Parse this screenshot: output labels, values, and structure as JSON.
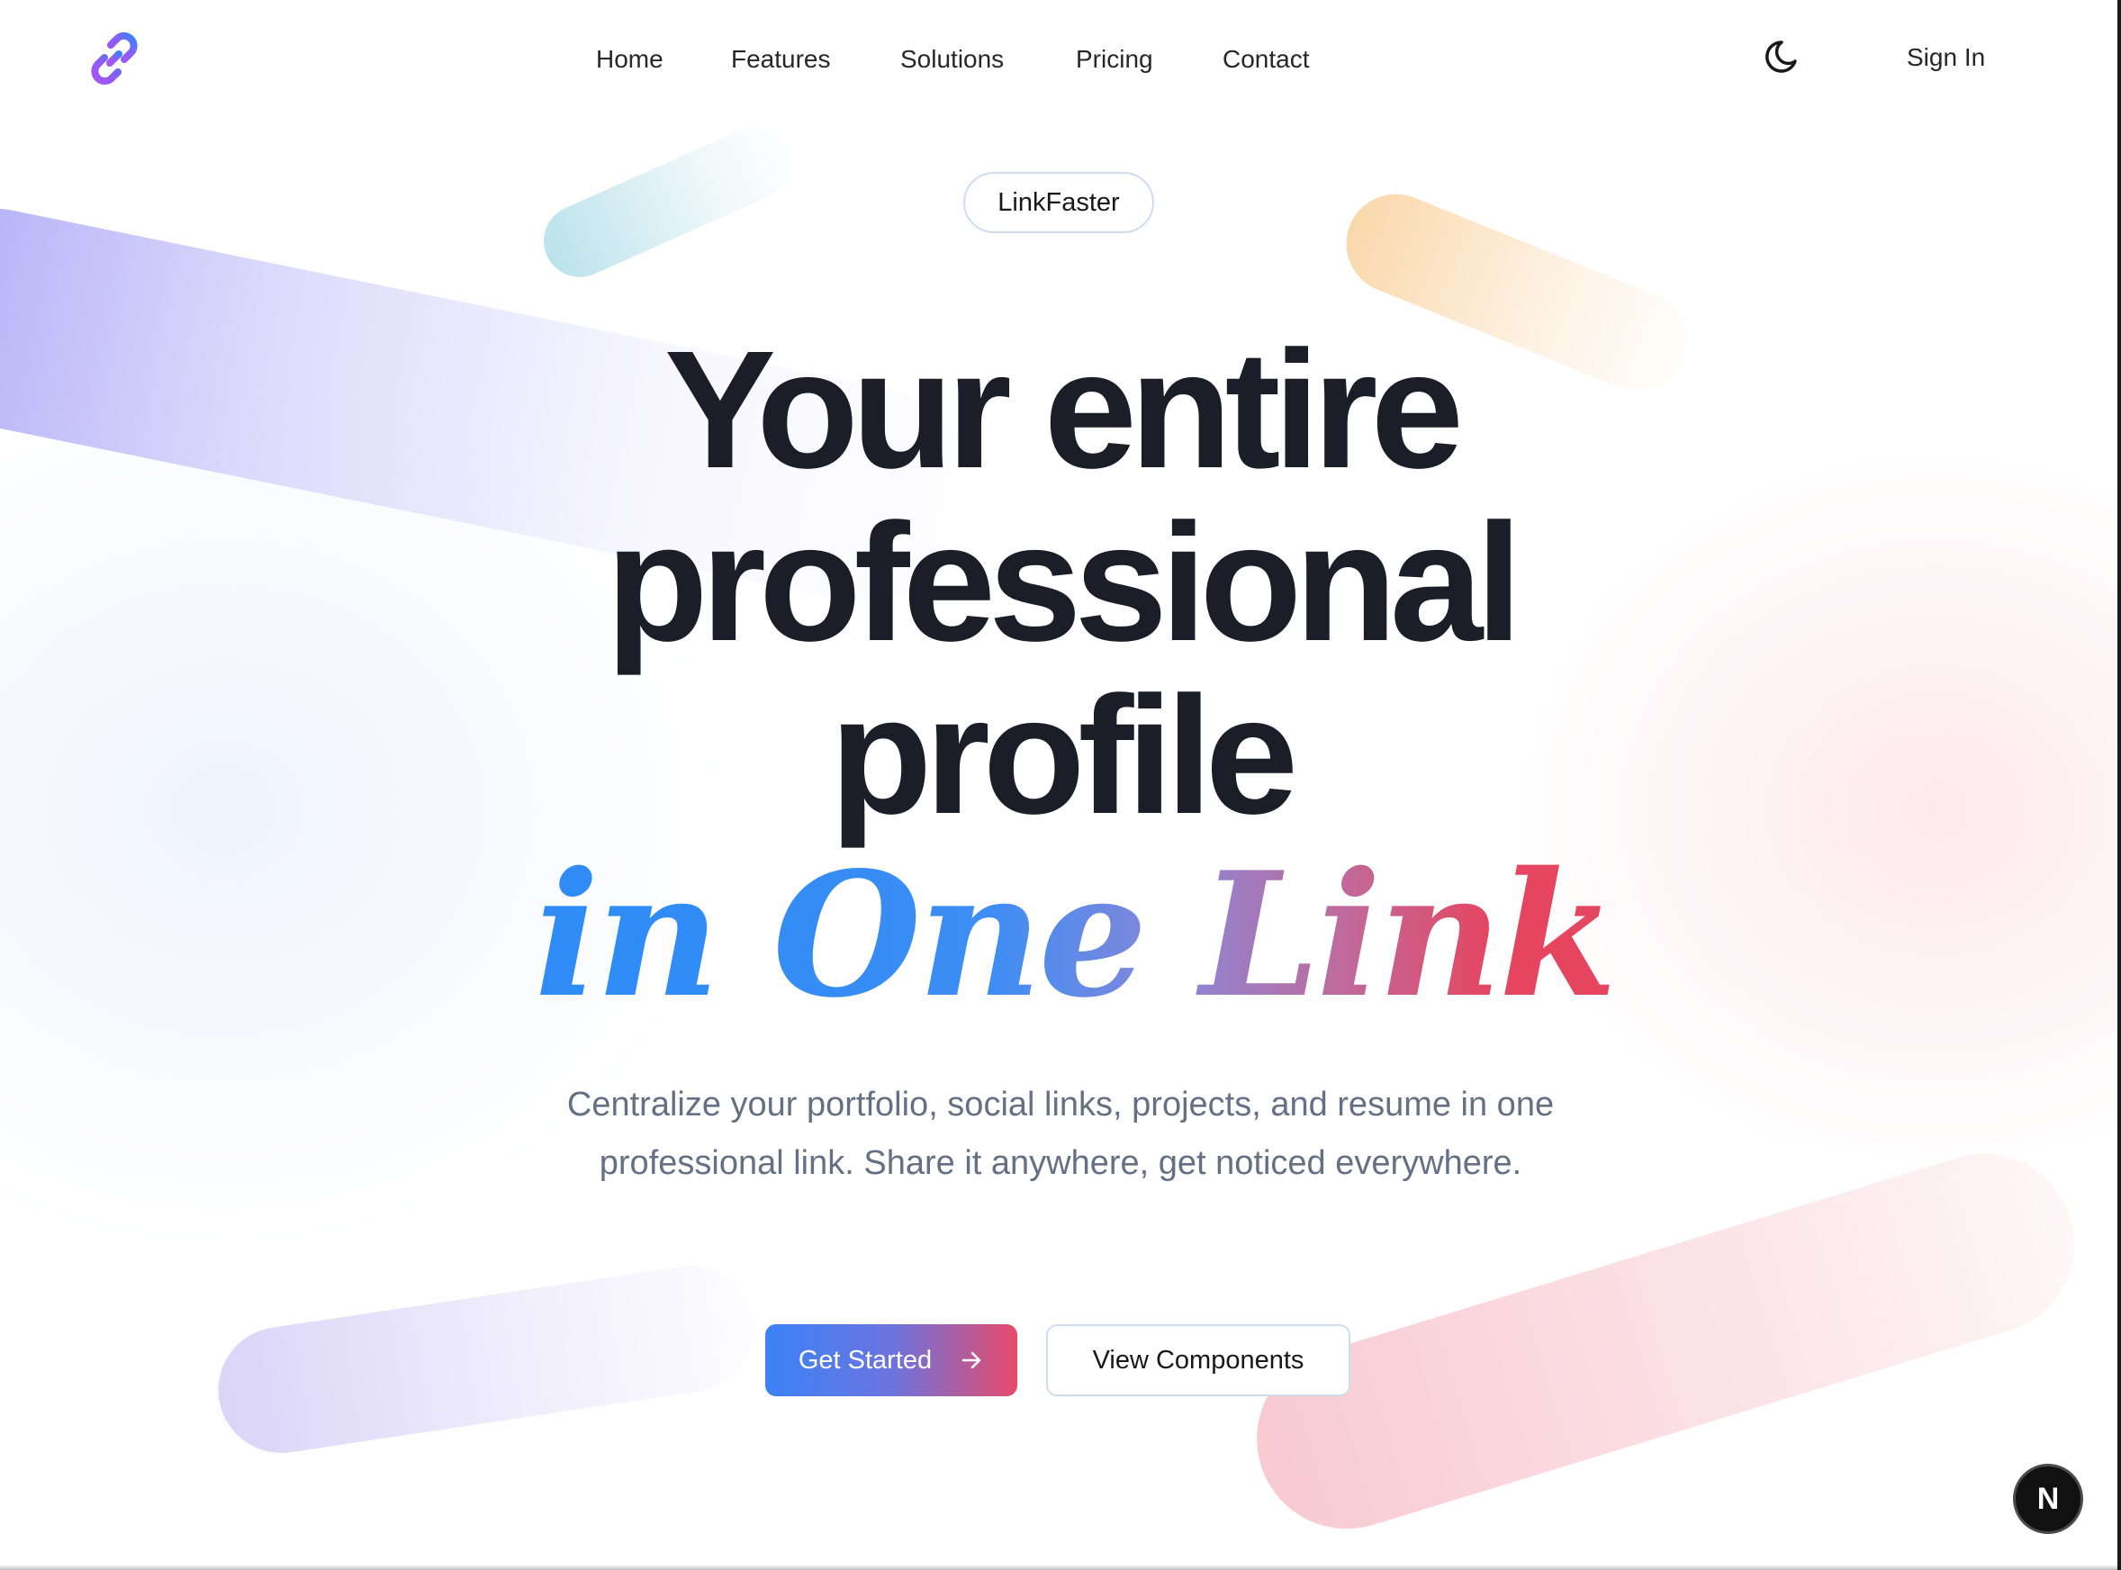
{
  "nav": {
    "logo": "link-chain-logo",
    "items": [
      {
        "label": "Home"
      },
      {
        "label": "Features"
      },
      {
        "label": "Solutions"
      },
      {
        "label": "Pricing"
      },
      {
        "label": "Contact"
      }
    ],
    "theme_toggle_icon": "moon-icon",
    "sign_in": "Sign In"
  },
  "hero": {
    "badge": "LinkFaster",
    "headline_lines": [
      "Your entire",
      "professional",
      "profile"
    ],
    "script_words": [
      "in",
      "One",
      "Link"
    ],
    "subtitle": "Centralize your portfolio, social links, projects, and resume in one professional link. Share it anywhere, get noticed everywhere.",
    "primary_cta": "Get Started",
    "primary_cta_icon": "arrow-right-icon",
    "secondary_cta": "View Components"
  },
  "floating_badge": "N",
  "colors": {
    "gradient_start": "#3b82f6",
    "gradient_mid": "#8b7fd8",
    "gradient_end": "#e64a6a",
    "heading": "#1c1d28",
    "subtitle": "#667085"
  }
}
